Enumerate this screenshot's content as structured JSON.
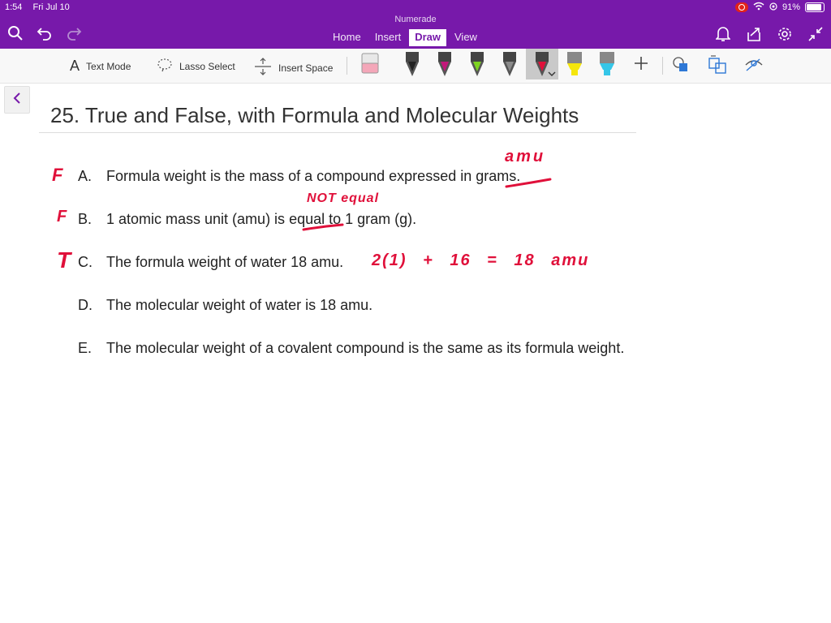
{
  "status": {
    "time": "1:54",
    "date": "Fri Jul 10",
    "battery": "91%"
  },
  "app": {
    "title": "Numerade"
  },
  "tabs": [
    {
      "label": "Home"
    },
    {
      "label": "Insert"
    },
    {
      "label": "Draw"
    },
    {
      "label": "View"
    }
  ],
  "toolbar": {
    "text_mode": "Text Mode",
    "lasso_select": "Lasso Select",
    "insert_space": "Insert Space"
  },
  "pens": [
    {
      "name": "eraser",
      "color": "#f4a7b9"
    },
    {
      "name": "black-pen",
      "color": "#222222"
    },
    {
      "name": "magenta-pen",
      "color": "#c2187a"
    },
    {
      "name": "green-pen",
      "color": "#7ed321"
    },
    {
      "name": "gray-pen",
      "color": "#8a8a8a"
    },
    {
      "name": "red-pen",
      "color": "#e0103a"
    },
    {
      "name": "yellow-highlighter",
      "color": "#f5e60c"
    },
    {
      "name": "cyan-highlighter",
      "color": "#35c6e8"
    }
  ],
  "page": {
    "title": "25. True and False, with Formula and Molecular Weights",
    "items": [
      {
        "letter": "A.",
        "pre": "Formula weight is the mass of a compound expressed in",
        "struck": "grams",
        "post": "."
      },
      {
        "letter": "B.",
        "pre": "1 atomic mass unit (amu) is",
        "struck": "equal",
        "post": "to 1 gram (g)."
      },
      {
        "letter": "C.",
        "text": "The formula weight of water 18 amu."
      },
      {
        "letter": "D.",
        "text": "The molecular weight of water is 18 amu."
      },
      {
        "letter": "E.",
        "text": "The molecular weight of a covalent compound is the same as its formula weight."
      }
    ]
  },
  "ink": {
    "mark_a": "F",
    "mark_b": "F",
    "mark_c": "T",
    "above_a": "amu",
    "above_b": "NOT equal",
    "calc_c": "2(1) + 16 = 18 amu",
    "color": "#e0103a"
  }
}
